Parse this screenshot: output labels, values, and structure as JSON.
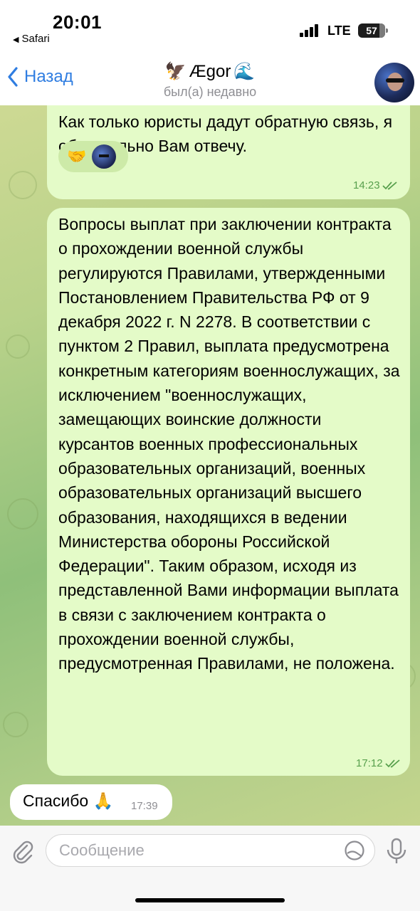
{
  "status_bar": {
    "time": "20:01",
    "back_app": "Safari",
    "network": "LTE",
    "battery": "57"
  },
  "header": {
    "back_label": "Назад",
    "title": "Ægor",
    "title_emoji_left": "🦅",
    "title_emoji_right": "🌊",
    "subtitle": "был(а) недавно"
  },
  "messages": [
    {
      "direction": "outgoing",
      "text": "Как только юристы дадут обратную связь, я обязательно Вам отвечу.",
      "time": "14:23",
      "read": true,
      "reaction": "🤝"
    },
    {
      "direction": "outgoing",
      "text": "Вопросы выплат при заключении контракта о прохождении военной службы регулируются Правилами, утвержденными Постановлением Правительства РФ от 9 декабря 2022 г. N 2278. В соответствии с пунктом 2 Правил, выплата предусмотрена конкретным категориям военнослужащих, за исключением \"военнослужащих, замещающих воинские должности курсантов военных профессиональных образовательных организаций, военных образовательных организаций высшего образования, находящихся в ведении Министерства обороны Российской Федерации\". Таким образом, исходя из представленной Вами информации выплата в связи с заключением контракта о прохождении военной службы, предусмотренная Правилами, не положена.",
      "time": "17:12",
      "read": true
    },
    {
      "direction": "incoming",
      "text": "Спасибо 🙏",
      "time": "17:39"
    }
  ],
  "composer": {
    "placeholder": "Сообщение"
  },
  "colors": {
    "outgoing_bubble": "#e4fbc8",
    "accent": "#2f7de1",
    "time_green": "#58a04d"
  },
  "icons": [
    "chevron-left-icon",
    "paperclip-icon",
    "sticker-icon",
    "microphone-icon",
    "double-check-icon",
    "signal-icon",
    "battery-icon"
  ]
}
